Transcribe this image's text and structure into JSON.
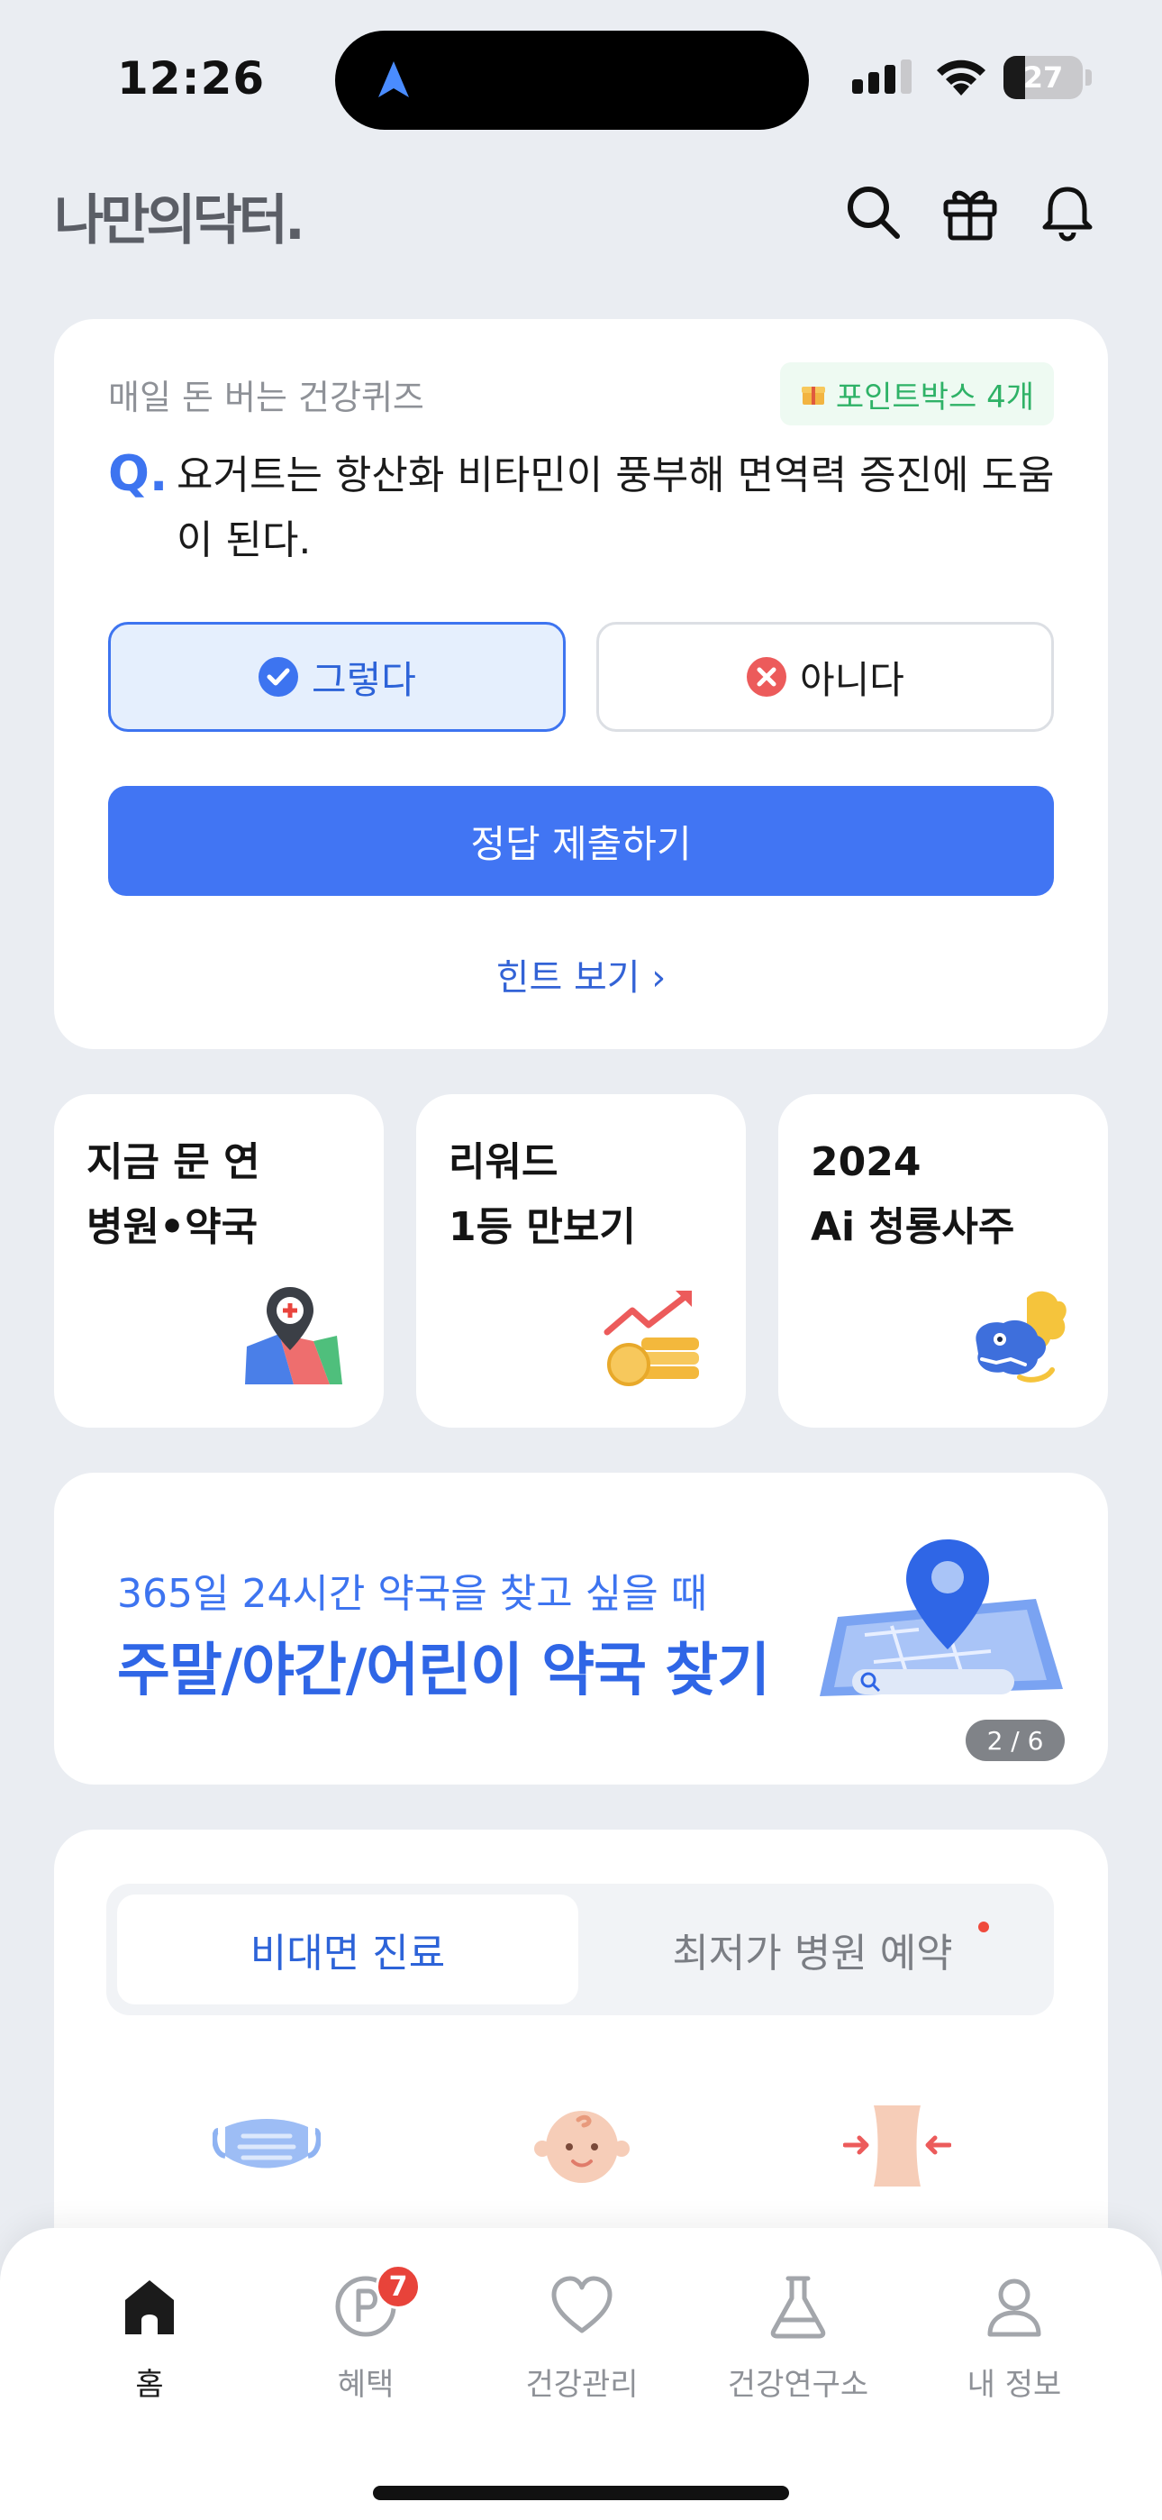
{
  "status_bar": {
    "time": "12:26",
    "battery": "27"
  },
  "header": {
    "logo": "나만의닥터."
  },
  "quiz": {
    "label": "매일 돈 버는 건강퀴즈",
    "points_badge": "포인트박스 4개",
    "q_mark": "Q.",
    "question": "요거트는 항산화 비타민이 풍부해 면역력 증진에 도움이 된다.",
    "answer_yes": "그렇다",
    "answer_no": "아니다",
    "submit_label": "정답 제출하기",
    "hint_label": "힌트 보기 ›"
  },
  "tiles": [
    {
      "line1": "지금 문 연",
      "line2": "병원•약국"
    },
    {
      "line1": "리워드",
      "line2": "1등 만보기"
    },
    {
      "line1": "2024",
      "line2": "Ai 청룡사주"
    }
  ],
  "banner": {
    "subtitle": "365일 24시간 약국을 찾고 싶을 때",
    "title": "주말/야간/어린이 약국 찾기",
    "pager": "2 / 6"
  },
  "section": {
    "tab_active": "비대면 진료",
    "tab_inactive": "최저가 병원 예약"
  },
  "bottom_nav": {
    "items": [
      {
        "label": "홈"
      },
      {
        "label": "혜택",
        "badge": "7"
      },
      {
        "label": "건강관리"
      },
      {
        "label": "건강연구소"
      },
      {
        "label": "내 정보"
      }
    ]
  },
  "colors": {
    "accent": "#4175f3",
    "active_tab_text": "#2d63d8",
    "points_green": "#2fb267",
    "badge_red": "#e8433a"
  },
  "progress": {
    "battery_level_percent": 27
  }
}
